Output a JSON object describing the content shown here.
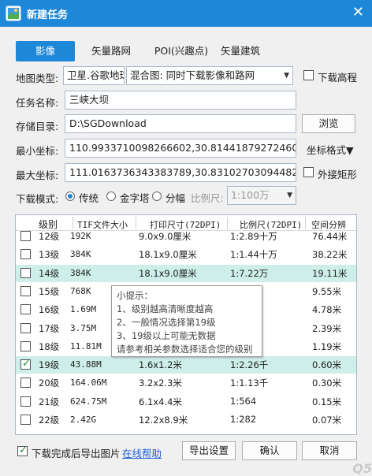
{
  "window": {
    "title": "新建任务",
    "close_glyph": "✕"
  },
  "tabs": [
    {
      "label": "影像",
      "active": true
    },
    {
      "label": "矢量路网",
      "active": false
    },
    {
      "label": "POI(兴趣点)",
      "active": false
    },
    {
      "label": "矢量建筑",
      "active": false
    }
  ],
  "map_type": {
    "label": "地图类型:",
    "source": "卫星.谷歌地球",
    "mode": "混合图: 同时下载影像和路网",
    "download_elevation_label": "下载高程",
    "download_elevation_checked": false
  },
  "task_name": {
    "label": "任务名称:",
    "value": "三峡大坝"
  },
  "storage": {
    "label": "存储目录:",
    "value": "D:\\SGDownload",
    "browse_label": "浏览"
  },
  "min_coord": {
    "label": "最小坐标:",
    "value": "110.9933710098266602,30.8144187927246094",
    "format_label": "坐标格式▼"
  },
  "max_coord": {
    "label": "最大坐标:",
    "value": "111.0163736343383789,30.8310270309448242",
    "outer_rect_label": "外接矩形",
    "outer_rect_checked": false
  },
  "download_mode": {
    "label": "下载模式:",
    "options": [
      {
        "label": "传统",
        "checked": true
      },
      {
        "label": "金字塔",
        "checked": false
      },
      {
        "label": "分幅",
        "checked": false
      }
    ],
    "scale_label": "比例尺:",
    "scale_value": "1:100万"
  },
  "table": {
    "headers": [
      "级别",
      "TIF文件大小",
      "打印尺寸(72DPI)",
      "比例尺(72DPI)",
      "空间分辨"
    ],
    "rows": [
      {
        "checked": false,
        "level": "12级",
        "size": "192K",
        "print": "9.0x9.0厘米",
        "scale": "1:2.89十万",
        "res": "76.44米",
        "hl": false
      },
      {
        "checked": false,
        "level": "13级",
        "size": "384K",
        "print": "18.1x9.0厘米",
        "scale": "1:1.44十万",
        "res": "38.22米",
        "hl": false
      },
      {
        "checked": false,
        "level": "14级",
        "size": "384K",
        "print": "18.1x9.0厘米",
        "scale": "1:7.22万",
        "res": "19.11米",
        "hl": true
      },
      {
        "checked": false,
        "level": "15级",
        "size": "768K",
        "print": "",
        "scale": "万",
        "res": "9.55米",
        "hl": false
      },
      {
        "checked": false,
        "level": "16级",
        "size": "1.69M",
        "print": "",
        "scale": "万",
        "res": "4.78米",
        "hl": false
      },
      {
        "checked": false,
        "level": "17级",
        "size": "3.75M",
        "print": "",
        "scale": "万",
        "res": "2.39米",
        "hl": false
      },
      {
        "checked": false,
        "level": "18级",
        "size": "11.81M",
        "print": "",
        "scale": "万",
        "res": "1.19米",
        "hl": false
      },
      {
        "checked": true,
        "level": "19级",
        "size": "43.88M",
        "print": "1.6x1.2米",
        "scale": "1:2.26千",
        "res": "0.60米",
        "hl": true
      },
      {
        "checked": false,
        "level": "20级",
        "size": "164.06M",
        "print": "3.2x2.3米",
        "scale": "1:1.13千",
        "res": "0.30米",
        "hl": false
      },
      {
        "checked": false,
        "level": "21级",
        "size": "624.75M",
        "print": "6.1x4.4米",
        "scale": "1:564",
        "res": "0.15米",
        "hl": false
      },
      {
        "checked": false,
        "level": "22级",
        "size": "2.42G",
        "print": "12.2x8.9米",
        "scale": "1:282",
        "res": "0.07米",
        "hl": false
      }
    ]
  },
  "tooltip": {
    "lines": [
      "小提示：",
      "1、级别越高清晰度越高",
      "2、一般情况选择第19级",
      "3、19级以上可能无数据",
      "请参考相关参数选择适合您的级别"
    ]
  },
  "footer": {
    "export_image_label": "下载完成后导出图片",
    "export_image_checked": true,
    "help_link": "在线帮助",
    "export_settings_label": "导出设置",
    "confirm_label": "确认",
    "cancel_label": "取消"
  },
  "colors": {
    "accent": "#1e88d8",
    "row_highlight": "#cdeee9",
    "link": "#1a5fd6"
  }
}
